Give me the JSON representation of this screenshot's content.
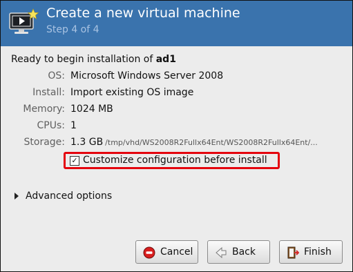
{
  "header": {
    "title": "Create a new virtual machine",
    "step": "Step 4 of 4"
  },
  "summary": {
    "ready_prefix": "Ready to begin installation of ",
    "vm_name": "ad1",
    "rows": [
      {
        "label": "OS:",
        "value": "Microsoft Windows Server 2008"
      },
      {
        "label": "Install:",
        "value": "Import existing OS image"
      },
      {
        "label": "Memory:",
        "value": "1024 MB"
      },
      {
        "label": "CPUs:",
        "value": "1"
      },
      {
        "label": "Storage:",
        "value": "1.3 GB",
        "path": "/tmp/vhd/WS2008R2Fullx64Ent/WS2008R2Fullx64Ent/..."
      }
    ]
  },
  "customize": {
    "label": "Customize configuration before install",
    "checked": true,
    "highlight_color": "#e4020d"
  },
  "advanced": {
    "label": "Advanced options",
    "expanded": false
  },
  "buttons": {
    "cancel": "Cancel",
    "back": "Back",
    "finish": "Finish"
  },
  "icons": {
    "header": "vm-monitor-new-icon",
    "cancel": "stop-sign-icon",
    "back": "back-arrow-icon",
    "finish": "exit-door-icon",
    "expander": "triangle-right-icon"
  },
  "colors": {
    "header_bg": "#3a73ad",
    "header_title": "#ffffff",
    "header_subtitle": "#a9c3e2"
  }
}
